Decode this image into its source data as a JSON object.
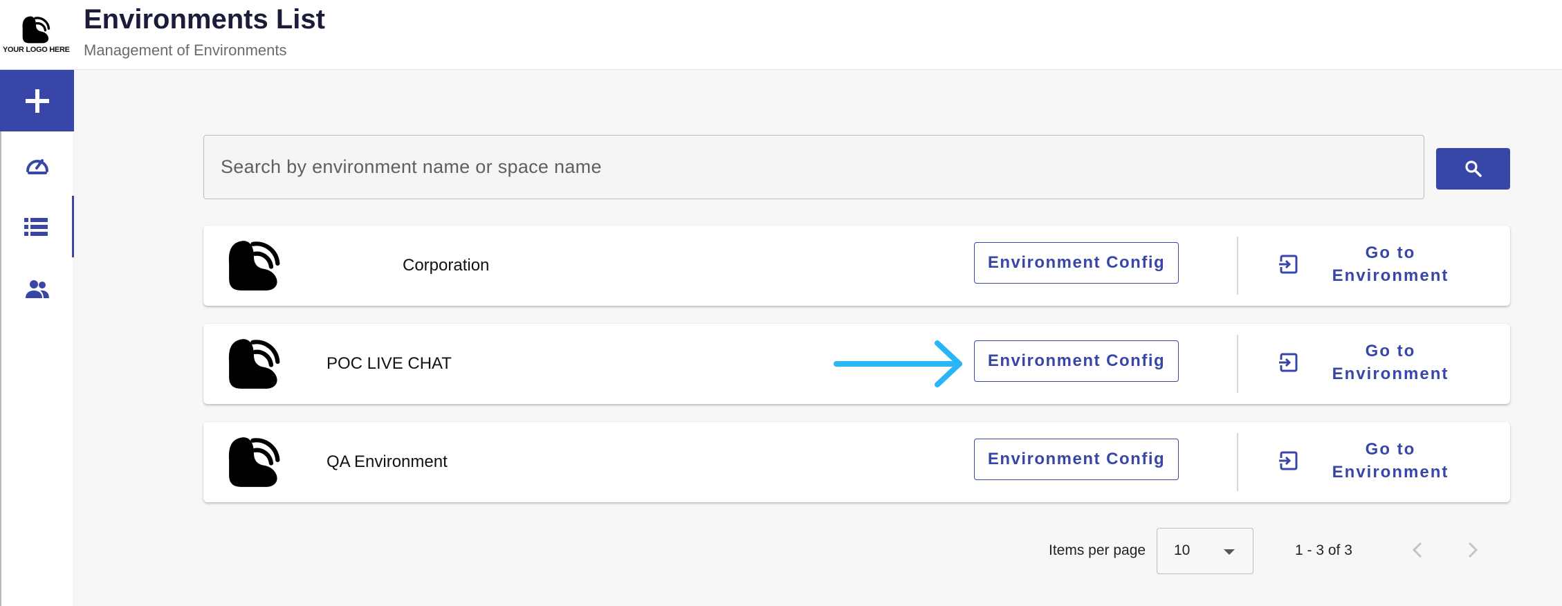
{
  "header": {
    "logo_text": "YOUR LOGO HERE",
    "title": "Environments List",
    "subtitle": "Management of Environments"
  },
  "sidebar": {
    "items": [
      {
        "icon": "plus-icon",
        "active_fill": true
      },
      {
        "icon": "speedometer-icon"
      },
      {
        "icon": "list-icon",
        "selected": true
      },
      {
        "icon": "people-icon"
      }
    ]
  },
  "search": {
    "placeholder": "Search by environment name or space name",
    "button_icon": "search-icon"
  },
  "environments": [
    {
      "name": "Corporation",
      "config_label": "Environment Config",
      "goto_label": "Go to\nEnvironment"
    },
    {
      "name": "POC LIVE CHAT",
      "config_label": "Environment Config",
      "goto_label": "Go to\nEnvironment"
    },
    {
      "name": "QA Environment",
      "config_label": "Environment Config",
      "goto_label": "Go to\nEnvironment"
    }
  ],
  "pagination": {
    "items_per_page_label": "Items per page",
    "items_per_page_value": "10",
    "range_label": "1 - 3 of 3"
  },
  "colors": {
    "primary": "#3846a8",
    "annotation_arrow": "#29b6f6"
  }
}
